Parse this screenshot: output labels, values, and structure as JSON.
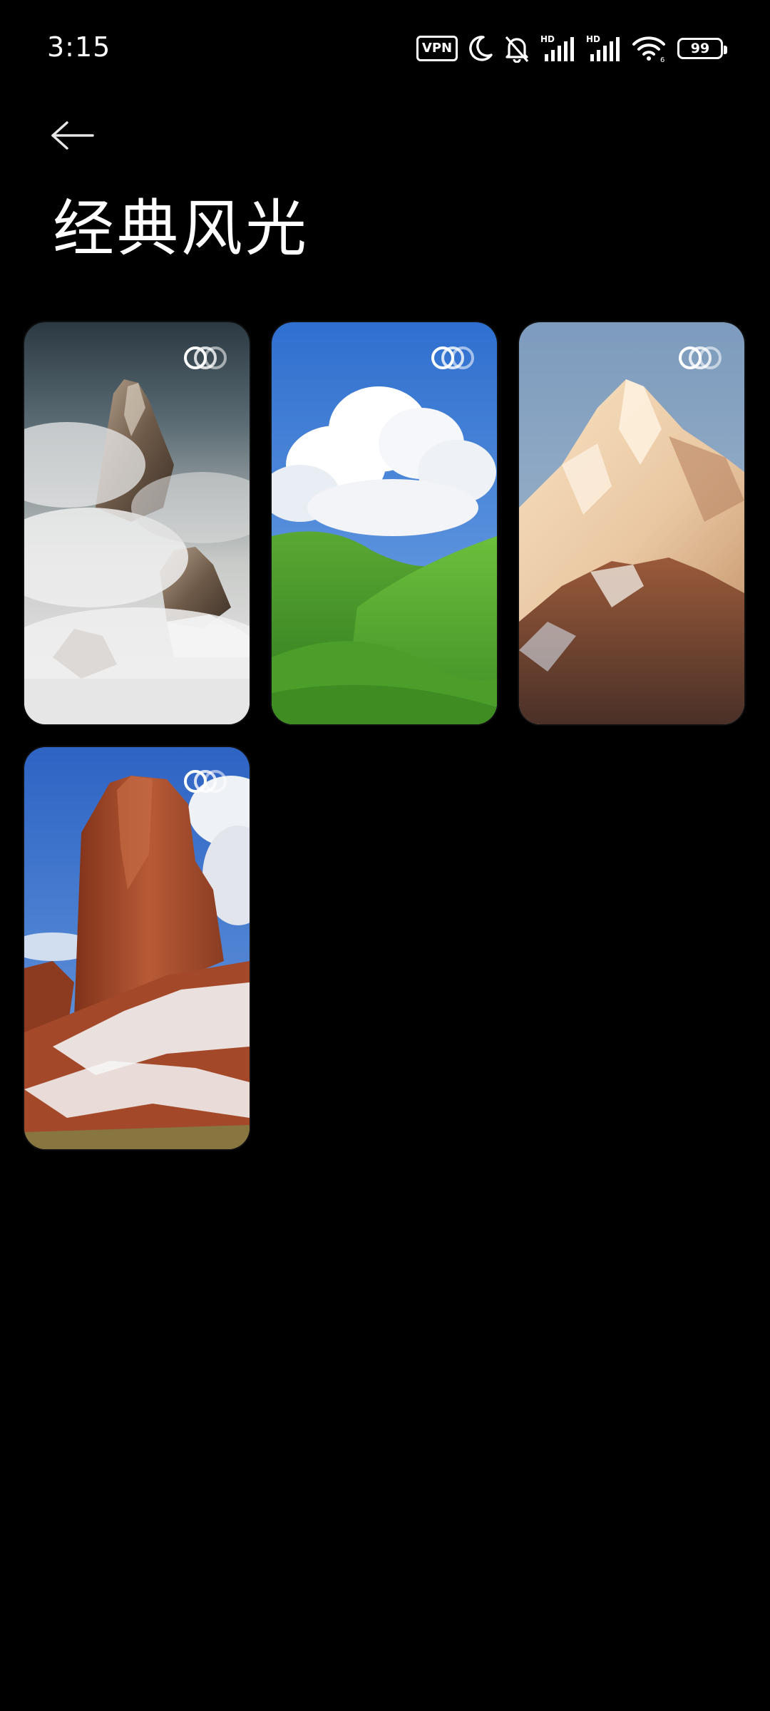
{
  "status_bar": {
    "time": "3:15",
    "vpn_label": "VPN",
    "battery_level": "99",
    "icons": [
      "vpn-icon",
      "moon-icon",
      "bell-off-icon",
      "signal-hd-icon",
      "signal-hd-icon",
      "wifi-icon",
      "battery-icon"
    ]
  },
  "header": {
    "back_icon": "arrow-left-icon",
    "title": "经典风光"
  },
  "wallpapers": [
    {
      "scene": "misty-rock-peaks",
      "badge_icon": "dynamic-wallpaper-icon"
    },
    {
      "scene": "green-hills-clouds",
      "badge_icon": "dynamic-wallpaper-icon"
    },
    {
      "scene": "snow-mountain-sunset",
      "badge_icon": "dynamic-wallpaper-icon"
    },
    {
      "scene": "red-rock-butte-snow",
      "badge_icon": "dynamic-wallpaper-icon"
    }
  ],
  "colors": {
    "background": "#000000",
    "text": "#ffffff",
    "sky_blue": "#3a7fd6",
    "grass_green": "#4e9a2c",
    "red_rock": "#a4482a"
  }
}
